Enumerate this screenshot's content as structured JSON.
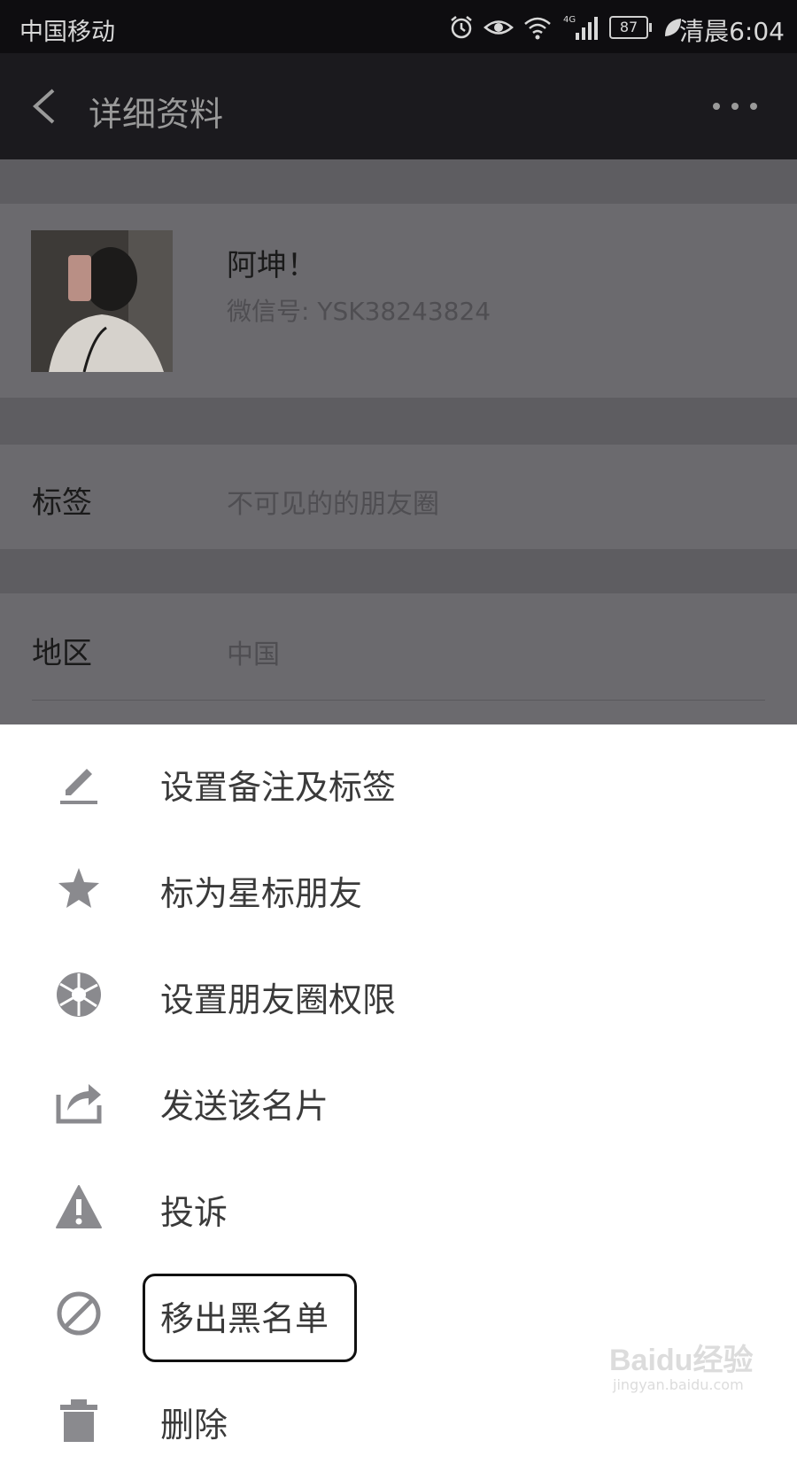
{
  "status_bar": {
    "carrier": "中国移动",
    "network": "4G",
    "battery": "87",
    "time": "清晨6:04"
  },
  "header": {
    "title": "详细资料",
    "back_icon": "chevron-left-icon",
    "more_icon": "more-dots-icon"
  },
  "profile": {
    "nickname": "阿坤！",
    "wechat_id": "微信号: YSK38243824"
  },
  "rows": [
    {
      "label": "标签",
      "value": "不可见的的朋友圈"
    },
    {
      "label": "地区",
      "value": "中国"
    }
  ],
  "menu": {
    "items": [
      {
        "label": "设置备注及标签",
        "icon": "pencil-icon"
      },
      {
        "label": "标为星标朋友",
        "icon": "star-icon"
      },
      {
        "label": "设置朋友圈权限",
        "icon": "aperture-icon"
      },
      {
        "label": "发送该名片",
        "icon": "share-icon"
      },
      {
        "label": "投诉",
        "icon": "warning-icon"
      },
      {
        "label": "移出黑名单",
        "icon": "block-icon",
        "highlighted": true
      },
      {
        "label": "删除",
        "icon": "trash-icon"
      }
    ]
  },
  "watermark": {
    "brand": "Baidu经验",
    "url": "jingyan.baidu.com"
  },
  "colors": {
    "dark_bar": "#1b1a1e",
    "dim_overlay": "#5e5d61",
    "menu_icon": "#8a8a8e",
    "menu_text": "#3a3a3a"
  }
}
